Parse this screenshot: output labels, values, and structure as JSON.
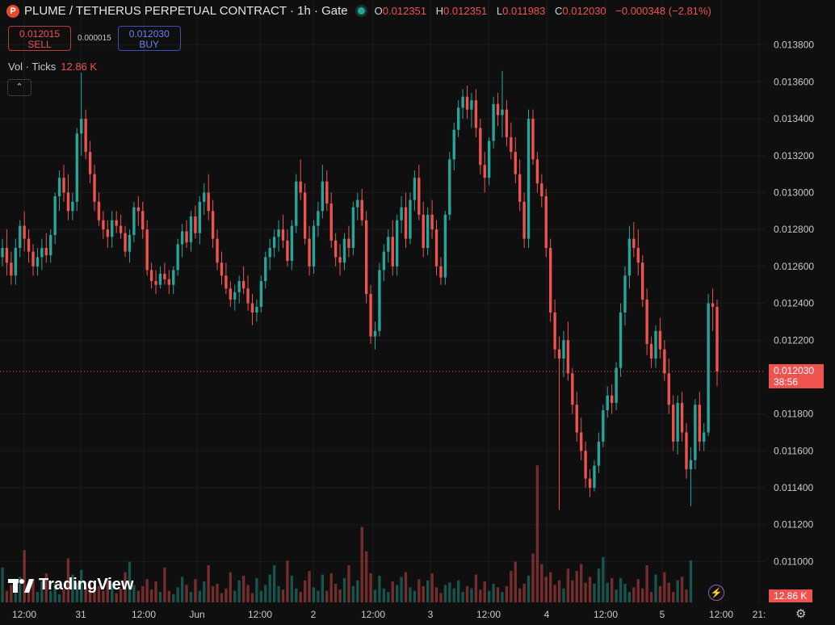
{
  "header": {
    "logo_letter": "P",
    "title": "PLUME / TETHERUS PERPETUAL CONTRACT · 1h · Gate",
    "o_label": "O",
    "o_value": "0.012351",
    "h_label": "H",
    "h_value": "0.012351",
    "l_label": "L",
    "l_value": "0.011983",
    "c_label": "C",
    "c_value": "0.012030",
    "change": "−0.000348 (−2.81%)"
  },
  "trade": {
    "sell_price": "0.012015",
    "sell_label": "SELL",
    "spread": "0.000015",
    "buy_price": "0.012030",
    "buy_label": "BUY"
  },
  "volume_legend": {
    "label": "Vol · Ticks",
    "value": "12.86 K"
  },
  "collapse_icon": "chevron-up",
  "price_tag": {
    "price": "0.012030",
    "countdown": "38:56"
  },
  "volume_tag": "12.86 K",
  "brand": "TradingView",
  "colors": {
    "up": "#26a69a",
    "down": "#ef5350",
    "bg": "#0f0f0f",
    "grid": "#1c1c1c"
  },
  "chart_data": {
    "type": "candlestick",
    "interval": "1h",
    "y_ticks": [
      "0.013800",
      "0.013600",
      "0.013400",
      "0.013200",
      "0.013000",
      "0.012800",
      "0.012600",
      "0.012400",
      "0.012200",
      "0.011800",
      "0.011600",
      "0.011400",
      "0.011200",
      "0.011000"
    ],
    "ylim": [
      0.01098,
      0.01386
    ],
    "last_price": 0.01203,
    "x_labels": [
      "12:00",
      "31",
      "12:00",
      "Jun",
      "12:00",
      "2",
      "12:00",
      "3",
      "12:00",
      "4",
      "12:00",
      "5",
      "12:00",
      "21:"
    ],
    "volume_scale_max": 12.86,
    "candles": [
      [
        0.01265,
        0.01275,
        0.0126,
        0.0127
      ],
      [
        0.0127,
        0.0128,
        0.01255,
        0.01262
      ],
      [
        0.01262,
        0.01268,
        0.0125,
        0.01255
      ],
      [
        0.01255,
        0.01275,
        0.0125,
        0.0127
      ],
      [
        0.0127,
        0.01285,
        0.01265,
        0.01282
      ],
      [
        0.01282,
        0.0129,
        0.01268,
        0.01275
      ],
      [
        0.01275,
        0.0128,
        0.01262,
        0.01268
      ],
      [
        0.01268,
        0.01272,
        0.01255,
        0.0126
      ],
      [
        0.0126,
        0.0127,
        0.01255,
        0.01265
      ],
      [
        0.01265,
        0.01275,
        0.01258,
        0.0127
      ],
      [
        0.0127,
        0.01278,
        0.01262,
        0.01266
      ],
      [
        0.01266,
        0.0128,
        0.01262,
        0.01277
      ],
      [
        0.01277,
        0.013,
        0.01272,
        0.01298
      ],
      [
        0.01298,
        0.01312,
        0.0129,
        0.01308
      ],
      [
        0.01308,
        0.01315,
        0.01295,
        0.013
      ],
      [
        0.013,
        0.0131,
        0.01285,
        0.0129
      ],
      [
        0.0129,
        0.013,
        0.01285,
        0.01295
      ],
      [
        0.01295,
        0.01335,
        0.0129,
        0.01332
      ],
      [
        0.01332,
        0.01365,
        0.0132,
        0.0134
      ],
      [
        0.0134,
        0.01345,
        0.01318,
        0.01322
      ],
      [
        0.01322,
        0.01328,
        0.01305,
        0.0131
      ],
      [
        0.0131,
        0.01315,
        0.0129,
        0.01295
      ],
      [
        0.01295,
        0.013,
        0.01282,
        0.01285
      ],
      [
        0.01285,
        0.0129,
        0.01275,
        0.0128
      ],
      [
        0.0128,
        0.01285,
        0.0127,
        0.01276
      ],
      [
        0.01276,
        0.0129,
        0.0127,
        0.01285
      ],
      [
        0.01285,
        0.0129,
        0.01278,
        0.01282
      ],
      [
        0.01282,
        0.01288,
        0.01275,
        0.01278
      ],
      [
        0.01278,
        0.01282,
        0.01265,
        0.01268
      ],
      [
        0.01268,
        0.0128,
        0.01262,
        0.01277
      ],
      [
        0.01277,
        0.01295,
        0.01273,
        0.01292
      ],
      [
        0.01292,
        0.01298,
        0.01282,
        0.0129
      ],
      [
        0.0129,
        0.01295,
        0.01275,
        0.0128
      ],
      [
        0.0128,
        0.01285,
        0.01255,
        0.01258
      ],
      [
        0.01258,
        0.01262,
        0.01248,
        0.01252
      ],
      [
        0.01252,
        0.01258,
        0.01245,
        0.0125
      ],
      [
        0.0125,
        0.0126,
        0.01248,
        0.01256
      ],
      [
        0.01256,
        0.01262,
        0.0125,
        0.01253
      ],
      [
        0.01253,
        0.01258,
        0.01245,
        0.0125
      ],
      [
        0.0125,
        0.0126,
        0.01245,
        0.01258
      ],
      [
        0.01258,
        0.01275,
        0.01255,
        0.01272
      ],
      [
        0.01272,
        0.01283,
        0.01265,
        0.01279
      ],
      [
        0.01279,
        0.01285,
        0.0127,
        0.01273
      ],
      [
        0.01273,
        0.0129,
        0.01268,
        0.01287
      ],
      [
        0.01287,
        0.01293,
        0.01275,
        0.01278
      ],
      [
        0.01278,
        0.01298,
        0.01272,
        0.01295
      ],
      [
        0.01295,
        0.01305,
        0.01288,
        0.013
      ],
      [
        0.013,
        0.0131,
        0.01285,
        0.0129
      ],
      [
        0.0129,
        0.01296,
        0.0127,
        0.01275
      ],
      [
        0.01275,
        0.0128,
        0.01258,
        0.01262
      ],
      [
        0.01262,
        0.01268,
        0.0125,
        0.01255
      ],
      [
        0.01255,
        0.01262,
        0.01245,
        0.01248
      ],
      [
        0.01248,
        0.01252,
        0.01238,
        0.01242
      ],
      [
        0.01242,
        0.0125,
        0.01236,
        0.01246
      ],
      [
        0.01246,
        0.01255,
        0.0124,
        0.01252
      ],
      [
        0.01252,
        0.0126,
        0.01245,
        0.01248
      ],
      [
        0.01248,
        0.01255,
        0.01236,
        0.0124
      ],
      [
        0.0124,
        0.01245,
        0.01228,
        0.01235
      ],
      [
        0.01235,
        0.01242,
        0.0123,
        0.01238
      ],
      [
        0.01238,
        0.01255,
        0.01235,
        0.01252
      ],
      [
        0.01252,
        0.01268,
        0.01248,
        0.01265
      ],
      [
        0.01265,
        0.01275,
        0.01258,
        0.0127
      ],
      [
        0.0127,
        0.0128,
        0.01265,
        0.01276
      ],
      [
        0.01276,
        0.01285,
        0.01268,
        0.0128
      ],
      [
        0.0128,
        0.01288,
        0.0127,
        0.01274
      ],
      [
        0.01274,
        0.0128,
        0.0126,
        0.01263
      ],
      [
        0.01263,
        0.01285,
        0.01258,
        0.01282
      ],
      [
        0.01282,
        0.0131,
        0.01278,
        0.01306
      ],
      [
        0.01306,
        0.01318,
        0.01296,
        0.013
      ],
      [
        0.013,
        0.01305,
        0.01272,
        0.01275
      ],
      [
        0.01275,
        0.01282,
        0.01255,
        0.0126
      ],
      [
        0.0126,
        0.01285,
        0.01256,
        0.01282
      ],
      [
        0.01282,
        0.01295,
        0.01276,
        0.0129
      ],
      [
        0.0129,
        0.01315,
        0.01286,
        0.01306
      ],
      [
        0.01306,
        0.01312,
        0.0129,
        0.01294
      ],
      [
        0.01294,
        0.013,
        0.0127,
        0.01274
      ],
      [
        0.01274,
        0.01278,
        0.0126,
        0.01265
      ],
      [
        0.01265,
        0.01272,
        0.01255,
        0.01262
      ],
      [
        0.01262,
        0.01278,
        0.01258,
        0.01275
      ],
      [
        0.01275,
        0.01282,
        0.01265,
        0.0127
      ],
      [
        0.0127,
        0.01295,
        0.01266,
        0.01292
      ],
      [
        0.01292,
        0.013,
        0.01285,
        0.01296
      ],
      [
        0.01296,
        0.01302,
        0.01282,
        0.01285
      ],
      [
        0.01285,
        0.0129,
        0.0124,
        0.01245
      ],
      [
        0.01245,
        0.0125,
        0.01218,
        0.01222
      ],
      [
        0.01222,
        0.0123,
        0.01215,
        0.01225
      ],
      [
        0.01225,
        0.01262,
        0.01222,
        0.01258
      ],
      [
        0.01258,
        0.01272,
        0.01252,
        0.01268
      ],
      [
        0.01268,
        0.0128,
        0.01262,
        0.01276
      ],
      [
        0.01276,
        0.01285,
        0.01255,
        0.0126
      ],
      [
        0.0126,
        0.01288,
        0.01255,
        0.01285
      ],
      [
        0.01285,
        0.01298,
        0.01278,
        0.01292
      ],
      [
        0.01292,
        0.013,
        0.0127,
        0.01275
      ],
      [
        0.01275,
        0.013,
        0.01272,
        0.01296
      ],
      [
        0.01296,
        0.01312,
        0.0129,
        0.01308
      ],
      [
        0.01308,
        0.01315,
        0.01285,
        0.01288
      ],
      [
        0.01288,
        0.01295,
        0.01265,
        0.0127
      ],
      [
        0.0127,
        0.01292,
        0.01266,
        0.01288
      ],
      [
        0.01288,
        0.01296,
        0.01275,
        0.0128
      ],
      [
        0.0128,
        0.01285,
        0.01255,
        0.0126
      ],
      [
        0.0126,
        0.01265,
        0.0125,
        0.01254
      ],
      [
        0.01254,
        0.0129,
        0.0125,
        0.01288
      ],
      [
        0.01288,
        0.01322,
        0.01285,
        0.01318
      ],
      [
        0.01318,
        0.01338,
        0.01312,
        0.01334
      ],
      [
        0.01334,
        0.0135,
        0.0133,
        0.01346
      ],
      [
        0.01346,
        0.01356,
        0.0134,
        0.01352
      ],
      [
        0.01352,
        0.01358,
        0.0134,
        0.01345
      ],
      [
        0.01345,
        0.01354,
        0.01335,
        0.0135
      ],
      [
        0.0135,
        0.01356,
        0.0133,
        0.01335
      ],
      [
        0.01335,
        0.0134,
        0.0131,
        0.01315
      ],
      [
        0.01315,
        0.01322,
        0.013,
        0.01308
      ],
      [
        0.01308,
        0.0133,
        0.01304,
        0.01328
      ],
      [
        0.01328,
        0.01352,
        0.01324,
        0.01348
      ],
      [
        0.01348,
        0.01354,
        0.01336,
        0.01342
      ],
      [
        0.01342,
        0.01366,
        0.0133,
        0.01345
      ],
      [
        0.01345,
        0.0135,
        0.01325,
        0.0133
      ],
      [
        0.0133,
        0.01338,
        0.01318,
        0.01322
      ],
      [
        0.01322,
        0.0133,
        0.01305,
        0.0131
      ],
      [
        0.0131,
        0.01318,
        0.0129,
        0.01295
      ],
      [
        0.01295,
        0.013,
        0.0127,
        0.01275
      ],
      [
        0.01275,
        0.01345,
        0.0127,
        0.0134
      ],
      [
        0.0134,
        0.01345,
        0.01315,
        0.01318
      ],
      [
        0.01318,
        0.01322,
        0.013,
        0.01305
      ],
      [
        0.01305,
        0.0131,
        0.01292,
        0.01298
      ],
      [
        0.01298,
        0.01302,
        0.01265,
        0.0127
      ],
      [
        0.0127,
        0.01275,
        0.0123,
        0.01235
      ],
      [
        0.01235,
        0.01242,
        0.0121,
        0.01215
      ],
      [
        0.01215,
        0.01222,
        0.01128,
        0.0121
      ],
      [
        0.0121,
        0.01225,
        0.012,
        0.0122
      ],
      [
        0.0122,
        0.0123,
        0.01198,
        0.01202
      ],
      [
        0.01202,
        0.01205,
        0.0118,
        0.01185
      ],
      [
        0.01185,
        0.01192,
        0.01165,
        0.0117
      ],
      [
        0.0117,
        0.01178,
        0.01155,
        0.0116
      ],
      [
        0.0116,
        0.01165,
        0.0114,
        0.01145
      ],
      [
        0.01145,
        0.0115,
        0.01135,
        0.0114
      ],
      [
        0.0114,
        0.01155,
        0.01138,
        0.01152
      ],
      [
        0.01152,
        0.0117,
        0.01148,
        0.01165
      ],
      [
        0.01165,
        0.01185,
        0.01162,
        0.01182
      ],
      [
        0.01182,
        0.01195,
        0.01178,
        0.0119
      ],
      [
        0.0119,
        0.01196,
        0.0118,
        0.01186
      ],
      [
        0.01186,
        0.01208,
        0.01182,
        0.01205
      ],
      [
        0.01205,
        0.0124,
        0.012,
        0.01235
      ],
      [
        0.01235,
        0.0126,
        0.01228,
        0.01255
      ],
      [
        0.01255,
        0.01282,
        0.01248,
        0.01275
      ],
      [
        0.01275,
        0.01284,
        0.01265,
        0.0127
      ],
      [
        0.0127,
        0.0128,
        0.01255,
        0.01262
      ],
      [
        0.01262,
        0.01266,
        0.01238,
        0.01242
      ],
      [
        0.01242,
        0.01248,
        0.01212,
        0.01218
      ],
      [
        0.01218,
        0.01222,
        0.01205,
        0.0121
      ],
      [
        0.0121,
        0.01228,
        0.01205,
        0.01225
      ],
      [
        0.01225,
        0.01232,
        0.0121,
        0.01215
      ],
      [
        0.01215,
        0.0122,
        0.01198,
        0.01202
      ],
      [
        0.01202,
        0.0121,
        0.0118,
        0.01185
      ],
      [
        0.01185,
        0.0119,
        0.0116,
        0.01165
      ],
      [
        0.01165,
        0.0119,
        0.01158,
        0.01186
      ],
      [
        0.01186,
        0.01192,
        0.01165,
        0.0117
      ],
      [
        0.0117,
        0.01175,
        0.01145,
        0.0115
      ],
      [
        0.0115,
        0.01162,
        0.0113,
        0.01155
      ],
      [
        0.01155,
        0.01188,
        0.0115,
        0.01185
      ],
      [
        0.01185,
        0.01192,
        0.0116,
        0.01165
      ],
      [
        0.01165,
        0.01175,
        0.0116,
        0.0117
      ],
      [
        0.0117,
        0.01245,
        0.01168,
        0.0124
      ],
      [
        0.0124,
        0.01248,
        0.01225,
        0.01238
      ],
      [
        0.01238,
        0.01242,
        0.01195,
        0.01203
      ]
    ],
    "volumes": [
      3.0,
      1.0,
      1.5,
      0.8,
      2.2,
      4.5,
      1.2,
      2.0,
      0.9,
      1.8,
      2.5,
      1.0,
      1.6,
      0.7,
      1.1,
      3.8,
      2.4,
      1.7,
      2.8,
      1.3,
      1.9,
      0.9,
      1.4,
      1.0,
      2.1,
      1.7,
      0.8,
      1.2,
      2.6,
      3.5,
      1.5,
      1.0,
      1.4,
      2.0,
      1.1,
      1.8,
      0.9,
      3.0,
      1.0,
      0.7,
      1.3,
      2.2,
      1.5,
      0.9,
      2.0,
      1.0,
      1.8,
      3.2,
      1.4,
      1.6,
      0.8,
      1.2,
      2.6,
      1.0,
      1.9,
      2.3,
      1.5,
      0.8,
      2.1,
      1.0,
      1.5,
      2.4,
      3.2,
      1.4,
      1.1,
      3.6,
      2.3,
      1.2,
      0.9,
      1.9,
      2.7,
      1.3,
      1.0,
      2.4,
      1.0,
      2.5,
      1.6,
      1.1,
      2.1,
      3.2,
      1.4,
      1.9,
      6.5,
      4.4,
      2.5,
      1.1,
      2.3,
      1.2,
      0.9,
      1.8,
      1.5,
      2.2,
      2.6,
      1.3,
      1.0,
      2.0,
      1.4,
      1.9,
      2.5,
      1.3,
      0.8,
      1.5,
      1.7,
      1.2,
      1.9,
      0.9,
      1.4,
      1.2,
      2.4,
      1.1,
      1.8,
      1.0,
      1.6,
      1.3,
      0.9,
      1.4,
      2.7,
      3.5,
      1.2,
      1.6,
      2.3,
      4.2,
      11.8,
      3.3,
      2.2,
      2.6,
      1.5,
      1.9,
      1.2,
      2.9,
      1.9,
      2.7,
      3.3,
      1.7,
      2.2,
      1.6,
      2.9,
      3.9,
      1.7,
      2.1,
      1.1,
      2.1,
      1.6,
      0.9,
      1.3,
      2.0,
      1.2,
      3.2,
      0.9,
      2.4,
      1.4,
      2.6,
      1.7,
      0.9,
      1.9,
      2.2,
      1.1,
      3.6
    ]
  }
}
